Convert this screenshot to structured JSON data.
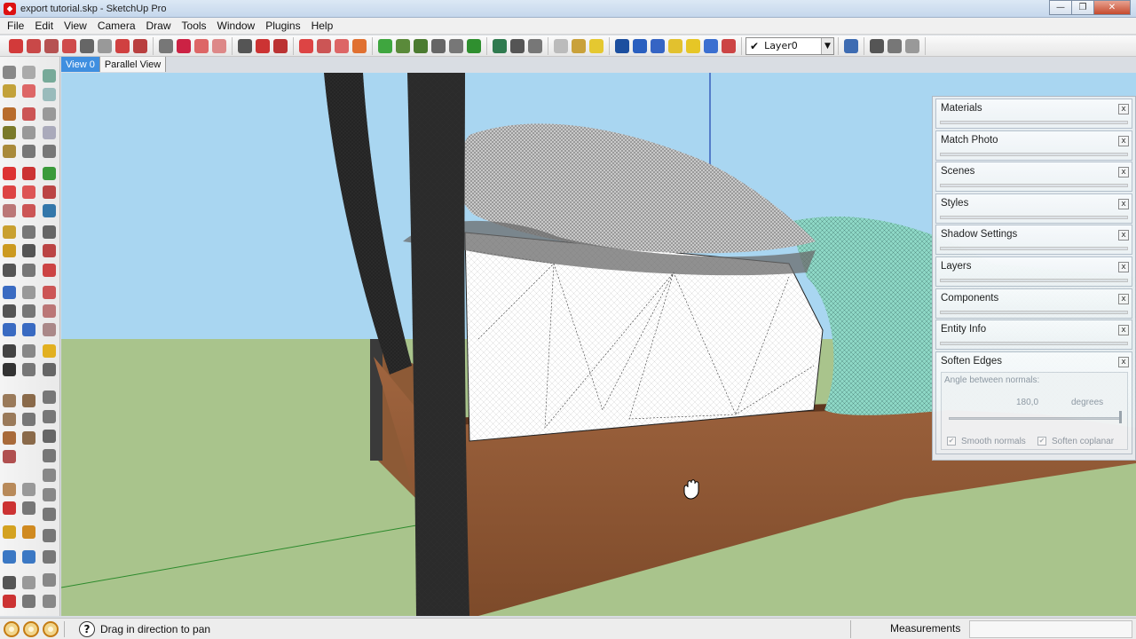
{
  "window": {
    "title": "export tutorial.skp - SketchUp Pro",
    "minimize_glyph": "—",
    "maximize_glyph": "❐",
    "close_glyph": "✕"
  },
  "menu": [
    "File",
    "Edit",
    "View",
    "Camera",
    "Draw",
    "Tools",
    "Window",
    "Plugins",
    "Help"
  ],
  "toolbar": {
    "layer_check": "✔",
    "layer_value": "Layer0",
    "layer_arrow": "▼"
  },
  "scene_tabs": [
    {
      "label": "View 0",
      "active": true
    },
    {
      "label": "Parallel View",
      "active": false
    }
  ],
  "tray": {
    "panels": [
      "Materials",
      "Match Photo",
      "Scenes",
      "Styles",
      "Shadow Settings",
      "Layers",
      "Components",
      "Entity Info"
    ],
    "close_glyph": "x",
    "soften_edges": {
      "title": "Soften Edges",
      "angle_label": "Angle between normals:",
      "angle_value": "180,0",
      "angle_unit": "degrees",
      "smooth_normals": "Smooth normals",
      "soften_coplanar": "Soften coplanar",
      "check_glyph": "✔"
    }
  },
  "status": {
    "help_glyph": "?",
    "message": "Drag in direction to pan",
    "measurements_label": "Measurements"
  },
  "colors": {
    "sky": "#a9d6f1",
    "ground": "#a9c48c",
    "wood": "#8f5634",
    "blanket": "#8ed8c6",
    "post": "#2b2b2b",
    "tab_active": "#3f8fe0"
  },
  "icons": {
    "viewport_cursor": "pan-hand-icon"
  }
}
